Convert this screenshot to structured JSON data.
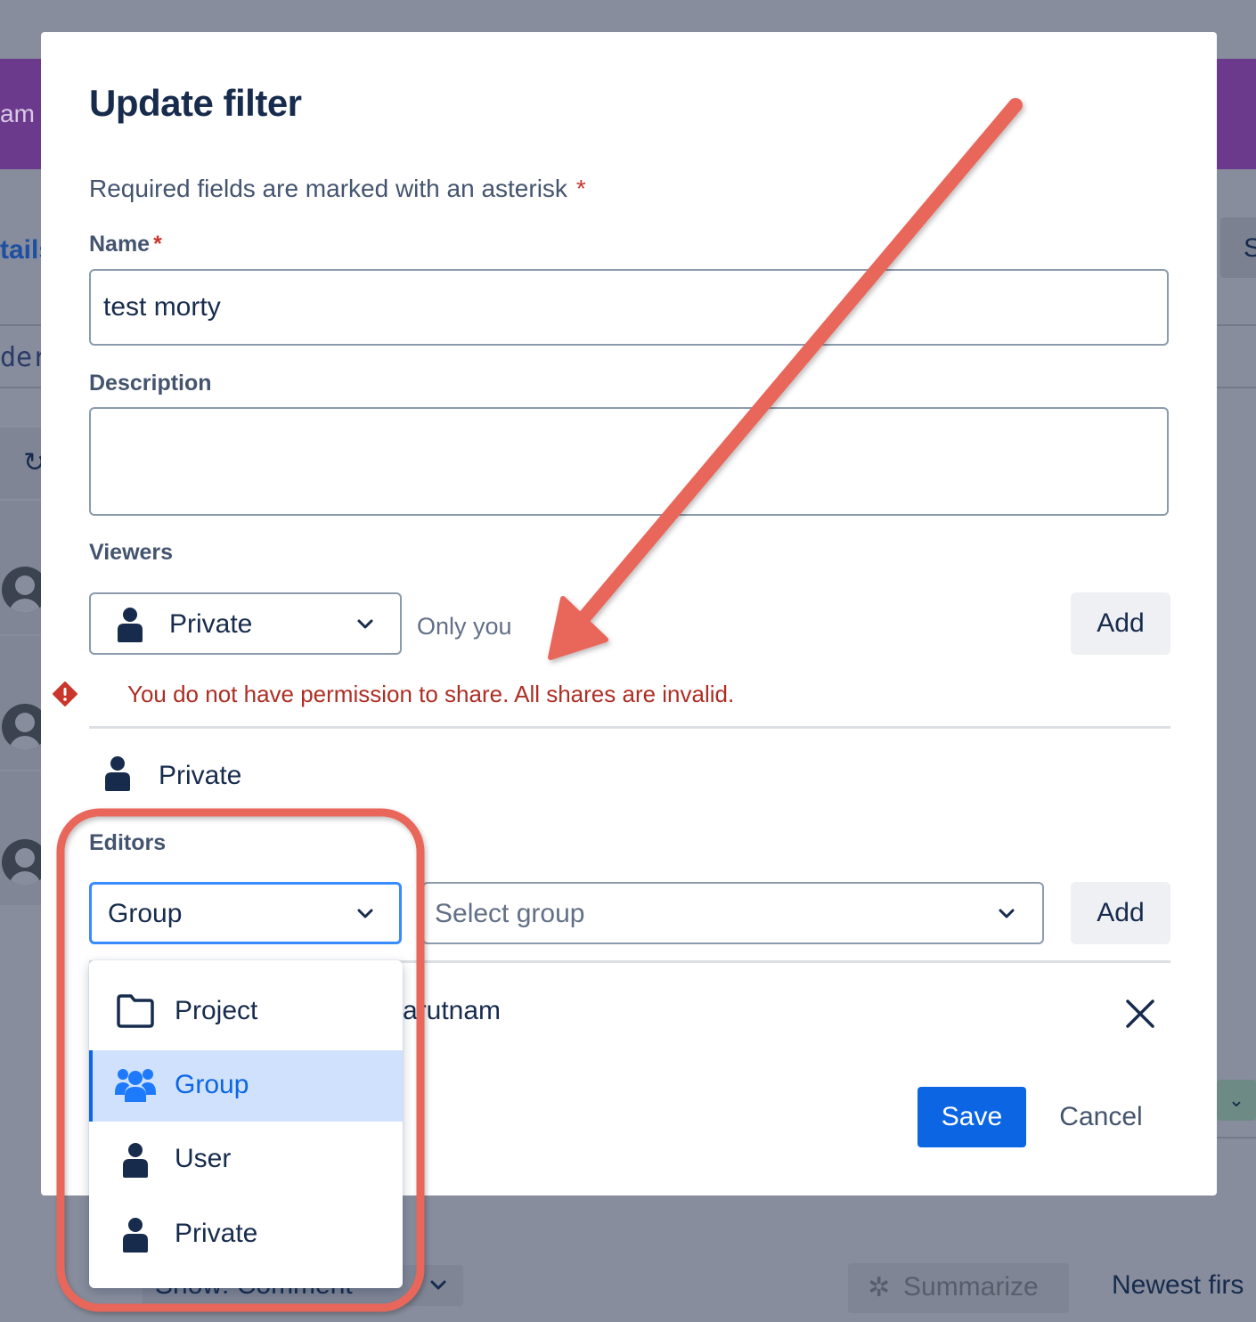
{
  "background": {
    "banner_text": "am",
    "tab_text": "tails",
    "right_tab_text": "S",
    "code_text": "der",
    "refresh_glyph": "↻",
    "show_text": "Show:  Comment",
    "summarize_label": "Summarize",
    "newest_label": "Newest firs"
  },
  "modal": {
    "title": "Update filter",
    "required_note": "Required fields are marked with an asterisk",
    "required_marker": "*",
    "name": {
      "label": "Name",
      "value": "test morty"
    },
    "description": {
      "label": "Description",
      "value": ""
    },
    "viewers": {
      "label": "Viewers",
      "select_value": "Private",
      "hint": "Only you",
      "add_label": "Add",
      "error": "You do not have permission to share. All shares are invalid.",
      "shares": [
        {
          "icon": "person-icon",
          "label": "Private"
        }
      ]
    },
    "editors": {
      "label": "Editors",
      "type_value": "Group",
      "group_placeholder": "Select group",
      "add_label": "Add",
      "shares": [
        {
          "icon": "group-icon",
          "label": "-arutnam"
        }
      ]
    },
    "save_label": "Save",
    "cancel_label": "Cancel"
  },
  "dropdown": {
    "items": [
      {
        "label": "Project",
        "icon": "folder-icon",
        "selected": false
      },
      {
        "label": "Group",
        "icon": "group-icon",
        "selected": true
      },
      {
        "label": "User",
        "icon": "person-icon",
        "selected": false
      },
      {
        "label": "Private",
        "icon": "person-icon",
        "selected": false
      }
    ]
  },
  "colors": {
    "primary": "#0c66e4",
    "error": "#ae2e24",
    "annotation": "#e8665a",
    "overlay": "#878d9c"
  }
}
